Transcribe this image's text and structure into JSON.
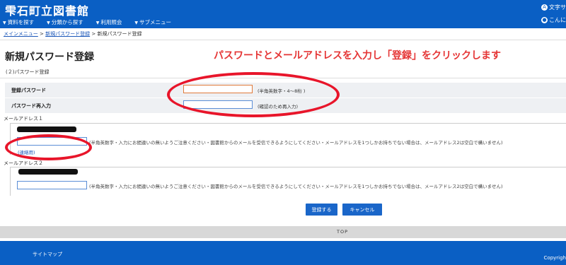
{
  "header": {
    "site_title": "雫石町立図書館",
    "font_size_label": "文字サ",
    "greeting": "こんに",
    "nav": [
      "資料を探す",
      "分類から探す",
      "利用照会",
      "サブメニュー"
    ]
  },
  "breadcrumb": {
    "items": [
      "メインメニュー",
      "新規パスワード登録"
    ],
    "separator": ">",
    "current": "新規パスワード登録"
  },
  "page": {
    "title": "新規パスワード登録",
    "instruction": "パスワードとメールアドレスを入力し「登録」をクリックします",
    "subtitle": "(２)パスワード登録"
  },
  "form": {
    "password_label": "登録パスワード",
    "password_note": "(半角英数字・4～8桁 )",
    "password_confirm_label": "パスワード再入力",
    "password_confirm_note": "(確認のため再入力)",
    "mail1_label": "メールアドレス１",
    "mail1_note": "(半角英数字・入力にお間違いの無いようご注意ください・図書館からのメールを受信できるようにしてください・メールアドレスを1つしかお持ちでない場合は、メールアドレス2は空白で構いません)",
    "contact_label": "(連絡用)",
    "mail2_label": "メールアドレス２",
    "mail2_note": "(半角英数字・入力にお間違いの無いようご注意ください・図書館からのメールを受信できるようにしてください・メールアドレスを1つしかお持ちでない場合は、メールアドレス2は空白で構いません)"
  },
  "buttons": {
    "register": "登録する",
    "cancel": "キャンセル"
  },
  "top_link": "TOP",
  "footer": {
    "sitemap": "サイトマップ",
    "copyright": "Copyrigh"
  },
  "colors": {
    "brand_blue": "#0a5fc4",
    "annotation_red": "#e8152a"
  }
}
